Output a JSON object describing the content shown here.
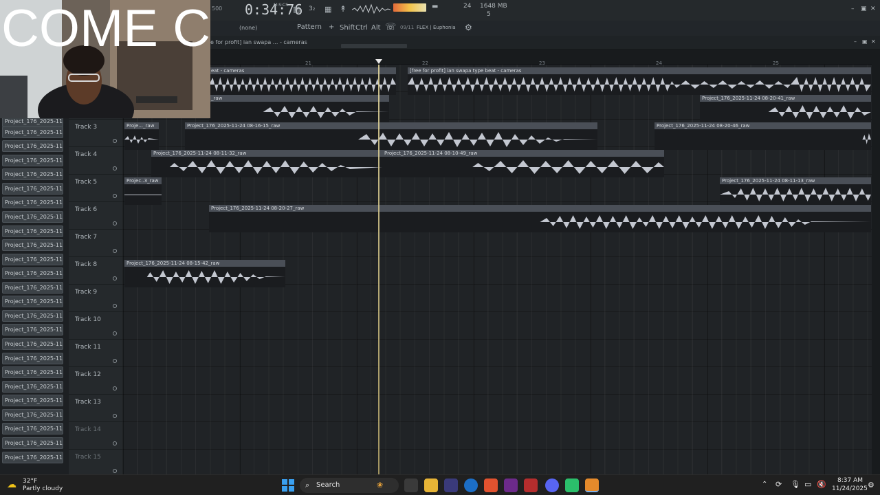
{
  "topbar": {
    "time": "0:34:76",
    "time_sub": "M:S:CS",
    "bpm": "500",
    "cpu": "24",
    "memory": "1648 MB",
    "polyphony": "5",
    "pattern_label": "Pattern",
    "plus": "+",
    "none_label": "(none)",
    "shift": "Shift",
    "ctrl": "Ctrl",
    "alt": "Alt",
    "hint_num": "09/11",
    "hint_text": "FLEX | Euphonia"
  },
  "playlist": {
    "breadcrumb": "e for profit] ian  swapa ... - cameras",
    "bar_numbers": [
      "21",
      "22",
      "23",
      "24",
      "25"
    ]
  },
  "overlay": {
    "text": "COME CHAT"
  },
  "patterns": [
    "Project_176_2025-11-24...",
    "Project_176_2025-11-24...",
    "Project_176_2025-11-24...",
    "Project_176_2025-11-24...",
    "Project_176_2025-11-24...",
    "Project_176_2025-11-24...",
    "Project_176_2025-11-24...",
    "Project_176_2025-11-24...",
    "Project_176_2025-11-24...",
    "Project_176_2025-11-24...",
    "Project_176_2025-11-24...",
    "Project_176_2025-11-24...",
    "Project_176_2025-11-24...",
    "Project_176_2025-11-24...",
    "Project_176_2025-11-24...",
    "Project_176_2025-11-24...",
    "Project_176_2025-11-24...",
    "Project_176_2025-11-24...",
    "Project_176_2025-11-24...",
    "Project_176_2025-11-24...",
    "Project_176_2025-11-24...",
    "Project_176_2025-11-24...",
    "Project_176_2025-11-24...",
    "Project_176_2025-11-24...",
    "Project_176_2025-11-24..."
  ],
  "tracks": [
    {
      "name": ""
    },
    {
      "name": ""
    },
    {
      "name": "Track 3"
    },
    {
      "name": "Track 4"
    },
    {
      "name": "Track 5"
    },
    {
      "name": "Track 6"
    },
    {
      "name": "Track 7"
    },
    {
      "name": "Track 8"
    },
    {
      "name": "Track 9"
    },
    {
      "name": "Track 10"
    },
    {
      "name": "Track 11"
    },
    {
      "name": "Track 12"
    },
    {
      "name": "Track 13"
    },
    {
      "name": "Track 14"
    },
    {
      "name": "Track 15"
    }
  ],
  "clips": [
    {
      "label": "eat - cameras"
    },
    {
      "label": "[free for profit] ian  swapa type beat - cameras"
    },
    {
      "label": "_raw"
    },
    {
      "label": "Project_176_2025-11-24 08-20-41_raw"
    },
    {
      "label": "Proje..._raw"
    },
    {
      "label": "Project_176_2025-11-24 08-16-15_raw"
    },
    {
      "label": "Project_176_2025-11-24 08-20-46_raw"
    },
    {
      "label": "Project_176_2025-11-24 08-11-32_raw"
    },
    {
      "label": "Project_176_2025-11-24 08-10-49_raw"
    },
    {
      "label": "Projec..3_raw"
    },
    {
      "label": "Project_176_2025-11-24 08-11-13_raw"
    },
    {
      "label": "Project_176_2025-11-24 08-20-27_raw"
    },
    {
      "label": "Project_176_2025-11-24 08-15-42_raw"
    }
  ],
  "taskbar": {
    "weather_temp": "32°F",
    "weather_desc": "Partly cloudy",
    "search": "Search",
    "time": "8:37 AM",
    "date": "11/24/2025"
  }
}
